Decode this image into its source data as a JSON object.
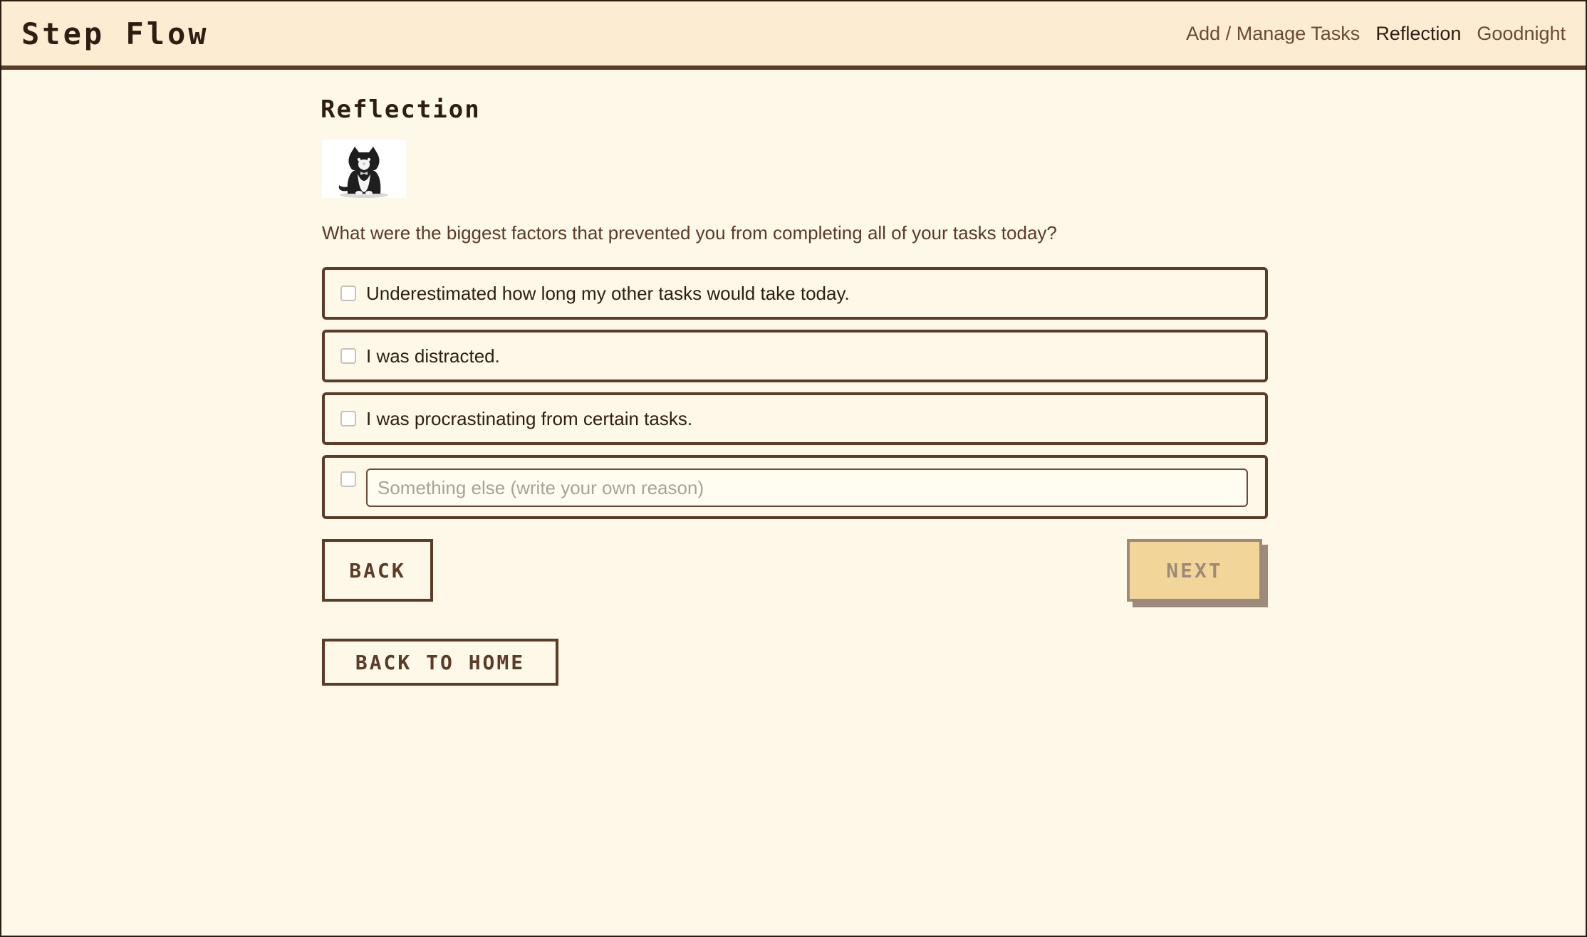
{
  "app": {
    "title": "Step Flow"
  },
  "nav": {
    "items": [
      {
        "label": "Add / Manage Tasks"
      },
      {
        "label": "Reflection"
      },
      {
        "label": "Goodnight"
      }
    ]
  },
  "page": {
    "title": "Reflection",
    "question": "What were the biggest factors that prevented you from completing all of your tasks today?"
  },
  "options": [
    {
      "label": "Underestimated how long my other tasks would take today."
    },
    {
      "label": "I was distracted."
    },
    {
      "label": "I was procrastinating from certain tasks."
    }
  ],
  "custom_option": {
    "placeholder": "Something else (write your own reason)",
    "value": ""
  },
  "buttons": {
    "back": "BACK",
    "next": "NEXT",
    "home": "BACK TO HOME"
  },
  "colors": {
    "background": "#fdf8e8",
    "header_bg": "#fcecd2",
    "border": "#5c3b27",
    "next_bg": "#f2d699",
    "next_text": "#9c8b7a"
  },
  "icons": {
    "mascot": "cat-icon"
  }
}
